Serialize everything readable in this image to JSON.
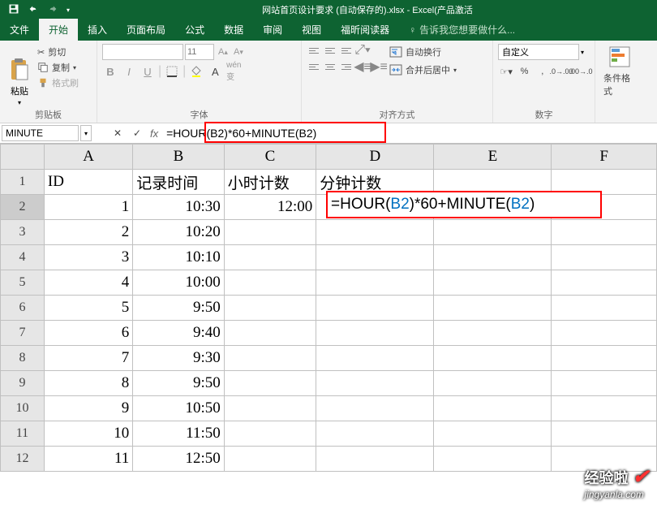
{
  "title": "网站首页设计要求 (自动保存的).xlsx - Excel(产品激活",
  "qat": {
    "save": "保存"
  },
  "tabs": {
    "file": "文件",
    "home": "开始",
    "insert": "插入",
    "layout": "页面布局",
    "formulas": "公式",
    "data": "数据",
    "review": "审阅",
    "view": "视图",
    "foxit": "福昕阅读器",
    "tellme": "告诉我您想要做什么..."
  },
  "ribbon": {
    "clipboard": {
      "paste": "粘贴",
      "cut": "剪切",
      "copy": "复制",
      "format_painter": "格式刷",
      "label": "剪贴板"
    },
    "font": {
      "font_size_placeholder": "11",
      "label": "字体"
    },
    "alignment": {
      "wrap": "自动换行",
      "merge": "合并后居中",
      "label": "对齐方式"
    },
    "number": {
      "format": "自定义",
      "label": "数字"
    },
    "styles": {
      "cond_fmt": "条件格式"
    }
  },
  "formula_bar": {
    "name_box": "MINUTE",
    "formula": "=HOUR(B2)*60+MINUTE(B2)"
  },
  "columns": [
    "A",
    "B",
    "C",
    "D",
    "E",
    "F"
  ],
  "rows": [
    "1",
    "2",
    "3",
    "4",
    "5",
    "6",
    "7",
    "8",
    "9",
    "10",
    "11",
    "12"
  ],
  "headers": {
    "A": "ID",
    "B": "记录时间",
    "C": "小时计数",
    "D": "分钟计数"
  },
  "data": [
    {
      "id": "1",
      "time": "10:30",
      "hour": "12:00"
    },
    {
      "id": "2",
      "time": "10:20",
      "hour": ""
    },
    {
      "id": "3",
      "time": "10:10",
      "hour": ""
    },
    {
      "id": "4",
      "time": "10:00",
      "hour": ""
    },
    {
      "id": "5",
      "time": "9:50",
      "hour": ""
    },
    {
      "id": "6",
      "time": "9:40",
      "hour": ""
    },
    {
      "id": "7",
      "time": "9:30",
      "hour": ""
    },
    {
      "id": "8",
      "time": "9:50",
      "hour": ""
    },
    {
      "id": "9",
      "time": "10:50",
      "hour": ""
    },
    {
      "id": "10",
      "time": "11:50",
      "hour": ""
    },
    {
      "id": "11",
      "time": "12:50",
      "hour": ""
    }
  ],
  "editing_formula": {
    "eq": "=",
    "fn1": "HOUR",
    "lp": "(",
    "ref": "B2",
    "rp": ")",
    "times60plus": "*60+",
    "fn2": "MINUTE"
  },
  "watermark": {
    "brand": "经验啦",
    "url": "jingyanla.com"
  }
}
